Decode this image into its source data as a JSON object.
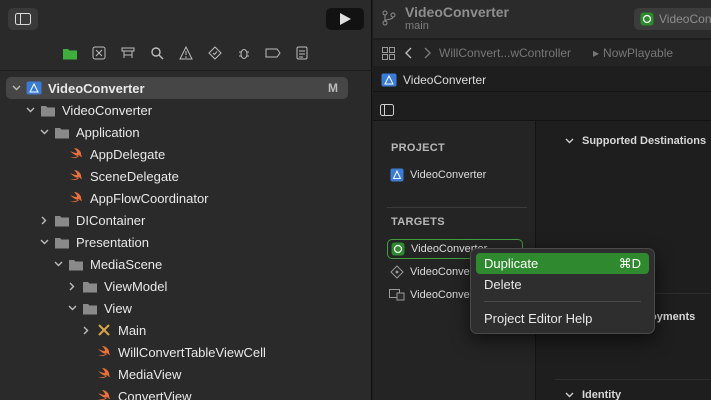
{
  "navigator": {
    "icons": [
      "folder-icon",
      "source-control-icon",
      "symbol-icon",
      "find-icon",
      "issue-icon",
      "test-icon",
      "debug-icon",
      "breakpoint-icon",
      "report-icon"
    ],
    "tree": [
      {
        "label": "VideoConverter",
        "kind": "project",
        "indent": 0,
        "chevron": "down",
        "badge": "M"
      },
      {
        "label": "VideoConverter",
        "kind": "folder",
        "indent": 1,
        "chevron": "down"
      },
      {
        "label": "Application",
        "kind": "folder",
        "indent": 2,
        "chevron": "down"
      },
      {
        "label": "AppDelegate",
        "kind": "swift",
        "indent": 3
      },
      {
        "label": "SceneDelegate",
        "kind": "swift",
        "indent": 3
      },
      {
        "label": "AppFlowCoordinator",
        "kind": "swift",
        "indent": 3
      },
      {
        "label": "DIContainer",
        "kind": "folder",
        "indent": 2,
        "chevron": "right"
      },
      {
        "label": "Presentation",
        "kind": "folder",
        "indent": 2,
        "chevron": "down"
      },
      {
        "label": "MediaScene",
        "kind": "folder",
        "indent": 3,
        "chevron": "down"
      },
      {
        "label": "ViewModel",
        "kind": "folder",
        "indent": 4,
        "chevron": "right"
      },
      {
        "label": "View",
        "kind": "folder",
        "indent": 4,
        "chevron": "down"
      },
      {
        "label": "Main",
        "kind": "xib",
        "indent": 5,
        "chevron": "right"
      },
      {
        "label": "WillConvertTableViewCell",
        "kind": "swift",
        "indent": 5
      },
      {
        "label": "MediaView",
        "kind": "swift",
        "indent": 5
      },
      {
        "label": "ConvertView",
        "kind": "swift",
        "indent": 5
      }
    ]
  },
  "editor": {
    "project_title": "VideoConverter",
    "branch": "main",
    "scheme": "VideoConv",
    "jumpbar": {
      "file": "WillConvert...wController",
      "item": "NowPlayable"
    },
    "breadcrumb": "VideoConverter",
    "project_section": "PROJECT",
    "project_item": "VideoConverter",
    "targets_section": "TARGETS",
    "targets": [
      "VideoConverter",
      "VideoConver",
      "VideoConver"
    ],
    "settings": {
      "supported": "Supported Destinations",
      "deployments": "loyments",
      "identity": "Identity"
    }
  },
  "context_menu": {
    "items": [
      {
        "label": "Duplicate",
        "shortcut": "⌘D"
      },
      {
        "label": "Delete",
        "shortcut": ""
      },
      {
        "label": "Project Editor Help",
        "shortcut": ""
      }
    ]
  },
  "colors": {
    "accent_green": "#2f8a2f",
    "folder": "#9a9a9a",
    "swift": "#e8703a",
    "project": "#3a7bd5"
  }
}
